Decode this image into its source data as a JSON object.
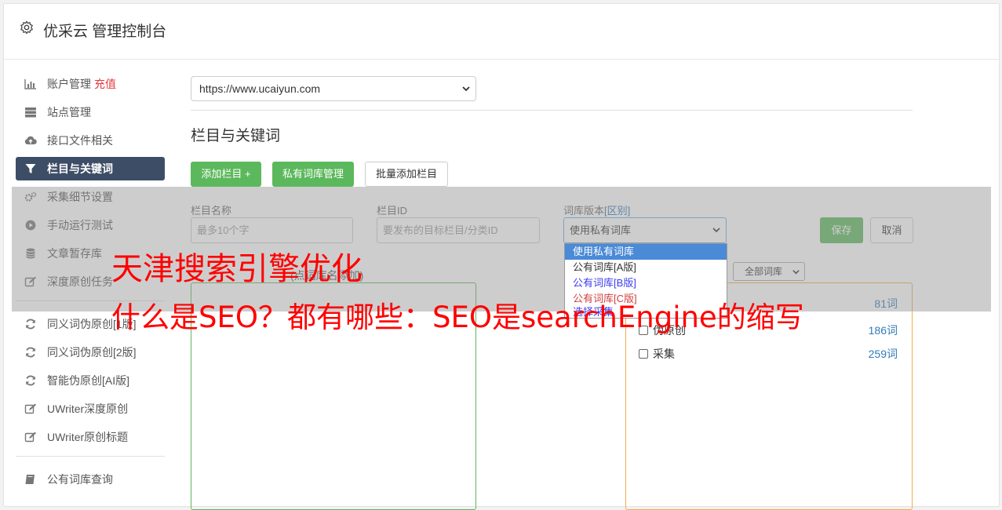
{
  "app": {
    "title": "优采云 管理控制台",
    "icon": "gear-icon"
  },
  "sidebar": {
    "items": [
      {
        "label": "账户管理",
        "badge": "充值",
        "icon": "bar-chart-icon"
      },
      {
        "label": "站点管理",
        "icon": "server-icon"
      },
      {
        "label": "接口文件相关",
        "icon": "cloud-upload-icon"
      },
      {
        "label": "栏目与关键词",
        "icon": "filter-icon",
        "active": true
      },
      {
        "label": "采集细节设置",
        "icon": "cogs-icon"
      },
      {
        "label": "手动运行测试",
        "icon": "play-circle-icon"
      },
      {
        "label": "文章暂存库",
        "icon": "database-icon"
      },
      {
        "label": "深度原创任务",
        "icon": "edit-icon"
      }
    ],
    "items2": [
      {
        "label": "同义词伪原创[1版]",
        "icon": "refresh-icon"
      },
      {
        "label": "同义词伪原创[2版]",
        "icon": "refresh-icon"
      },
      {
        "label": "智能伪原创[AI版]",
        "icon": "refresh-icon"
      },
      {
        "label": "UWriter深度原创",
        "icon": "edit-icon"
      },
      {
        "label": "UWriter原创标题",
        "icon": "edit-icon"
      }
    ],
    "items3": [
      {
        "label": "公有词库查询",
        "icon": "book-icon"
      }
    ]
  },
  "main": {
    "site_select": "https://www.ucaiyun.com",
    "section_title": "栏目与关键词",
    "buttons": {
      "add_column": "添加栏目 +",
      "private_lib": "私有词库管理",
      "batch_add": "批量添加栏目"
    },
    "form": {
      "name_label": "栏目名称",
      "name_placeholder": "最多10个字",
      "id_label": "栏目ID",
      "id_placeholder": "要发布的目标栏目/分类ID",
      "lib_label": "词库版本",
      "lib_label_link": "[区别]",
      "lib_value": "使用私有词库",
      "save": "保存",
      "cancel": "取消"
    },
    "dropdown_options": [
      "使用私有词库",
      "公有词库[A版]",
      "公有词库[B版]",
      "公有词库[C版]",
      "选择采集"
    ],
    "hint": "(点词库名添加)",
    "filter_select": "全部词库",
    "lib_rows": [
      {
        "name": "伪原创",
        "count": "186词"
      },
      {
        "name": "采集",
        "count": "259词"
      }
    ],
    "partial_count": "81词"
  },
  "overlay": {
    "line1": "天津搜索引擎优化",
    "line2": "什么是SEO？都有哪些：SEO是searchEngine的缩写"
  },
  "colors": {
    "accent_green": "#5cb85c",
    "active_nav": "#3d4d65",
    "overlay_text": "#ff0000",
    "link": "#337ab7"
  }
}
